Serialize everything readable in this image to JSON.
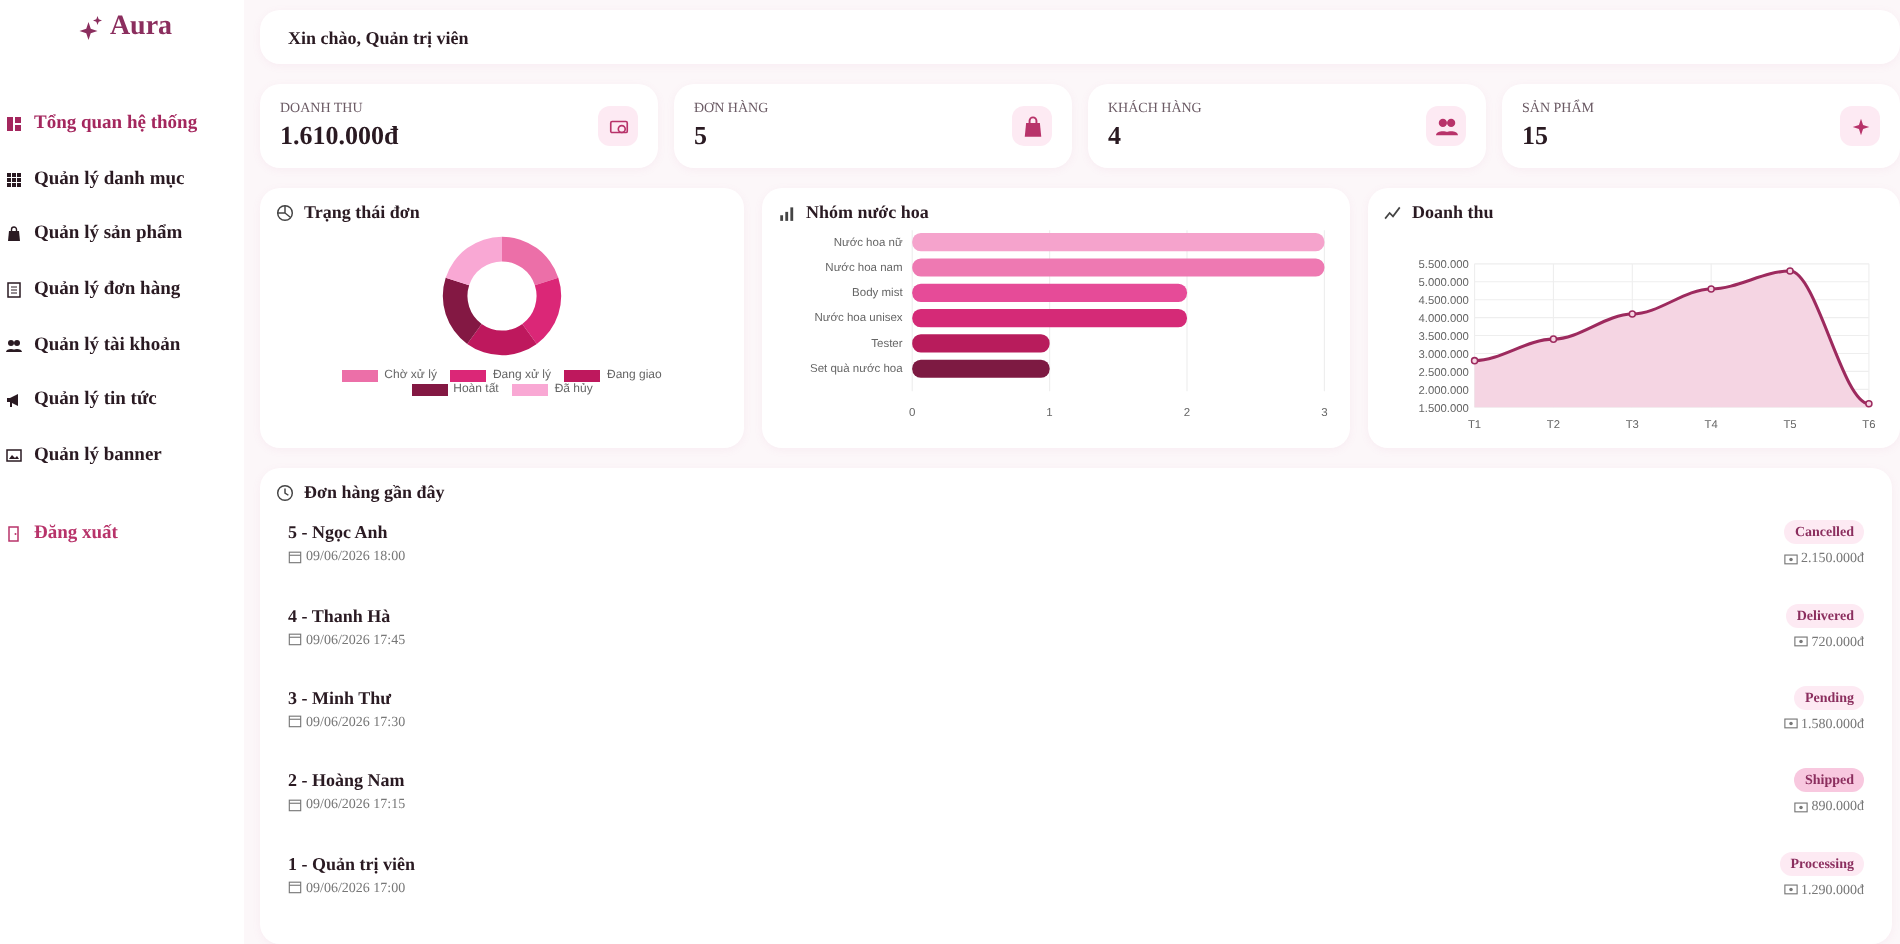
{
  "brand": {
    "name": "Aura"
  },
  "sidebar": {
    "items": [
      {
        "label": "Tổng quan hệ thống",
        "selected": true
      },
      {
        "label": "Quản lý danh mục",
        "selected": false
      },
      {
        "label": "Quản lý sản phẩm",
        "selected": false
      },
      {
        "label": "Quản lý đơn hàng",
        "selected": false
      },
      {
        "label": "Quản lý tài khoản",
        "selected": false
      },
      {
        "label": "Quản lý tin tức",
        "selected": false
      },
      {
        "label": "Quản lý banner",
        "selected": false
      }
    ],
    "logout": "Đăng xuất"
  },
  "header": {
    "greeting": "Xin chào, Quản trị viên"
  },
  "stats": [
    {
      "label": "DOANH THU",
      "value": "1.610.000đ"
    },
    {
      "label": "ĐƠN HÀNG",
      "value": "5"
    },
    {
      "label": "KHÁCH HÀNG",
      "value": "4"
    },
    {
      "label": "SẢN PHẨM",
      "value": "15"
    }
  ],
  "charts": [
    {
      "title": "Trạng thái đơn",
      "chart_data": {
        "type": "donut",
        "categories": [
          "Chờ xử lý",
          "Đang xử lý",
          "Đang giao",
          "Hoàn tất",
          "Đã hủy"
        ],
        "legend": "bottom",
        "values": [
          20,
          20,
          20,
          20,
          20
        ]
      }
    },
    {
      "title": "Nhóm nước hoa",
      "chart_data": {
        "type": "bar",
        "orientation": "horizontal",
        "categories": [
          "Nước hoa nữ",
          "Nước hoa nam",
          "Body mist",
          "Nước hoa unisex",
          "Tester",
          "Set quà nước hoa"
        ],
        "values": [
          3,
          3,
          2,
          2,
          1,
          1
        ],
        "xlim": [
          0,
          3
        ],
        "xticks": [
          0,
          1,
          2,
          3
        ],
        "grid": true
      }
    },
    {
      "title": "Doanh thu",
      "chart_data": {
        "type": "area",
        "categories": [
          "T1",
          "T2",
          "T3",
          "T4",
          "T5",
          "T6"
        ],
        "grid": true,
        "series": [
          {
            "color": "#9d2a5e",
            "values": [
              2800000,
              3400000,
              4100000,
              4800000,
              5300000,
              1600000
            ]
          }
        ],
        "ylim": [
          1500000,
          5500000
        ],
        "yticks": [
          {
            "value": 1500000,
            "label": "1.500.000"
          },
          {
            "value": 2000000,
            "label": "2.000.000"
          },
          {
            "value": 2500000,
            "label": "2.500.000"
          },
          {
            "value": 3000000,
            "label": "3.000.000"
          },
          {
            "value": 3500000,
            "label": "3.500.000"
          },
          {
            "value": 4000000,
            "label": "4.000.000"
          },
          {
            "value": 4500000,
            "label": "4.500.000"
          },
          {
            "value": 5000000,
            "label": "5.000.000"
          },
          {
            "value": 5500000,
            "label": "5.500.000"
          }
        ]
      }
    }
  ],
  "orders": {
    "title": "Đơn hàng gần đây",
    "items": [
      {
        "name": "5 - Ngọc Anh",
        "time": "09/06/2026 18:00",
        "status": "Cancelled",
        "kind": "light",
        "total": "2.150.000đ"
      },
      {
        "name": "4 - Thanh Hà",
        "time": "09/06/2026 17:45",
        "status": "Delivered",
        "kind": "light",
        "total": "720.000đ"
      },
      {
        "name": "3 - Minh Thư",
        "time": "09/06/2026 17:30",
        "status": "Pending",
        "kind": "light",
        "total": "1.580.000đ"
      },
      {
        "name": "2 - Hoàng Nam",
        "time": "09/06/2026 17:15",
        "status": "Shipped",
        "kind": "strong",
        "total": "890.000đ"
      },
      {
        "name": "1 - Quản trị viên",
        "time": "09/06/2026 17:00",
        "status": "Processing",
        "kind": "light",
        "total": "1.290.000đ"
      }
    ]
  }
}
